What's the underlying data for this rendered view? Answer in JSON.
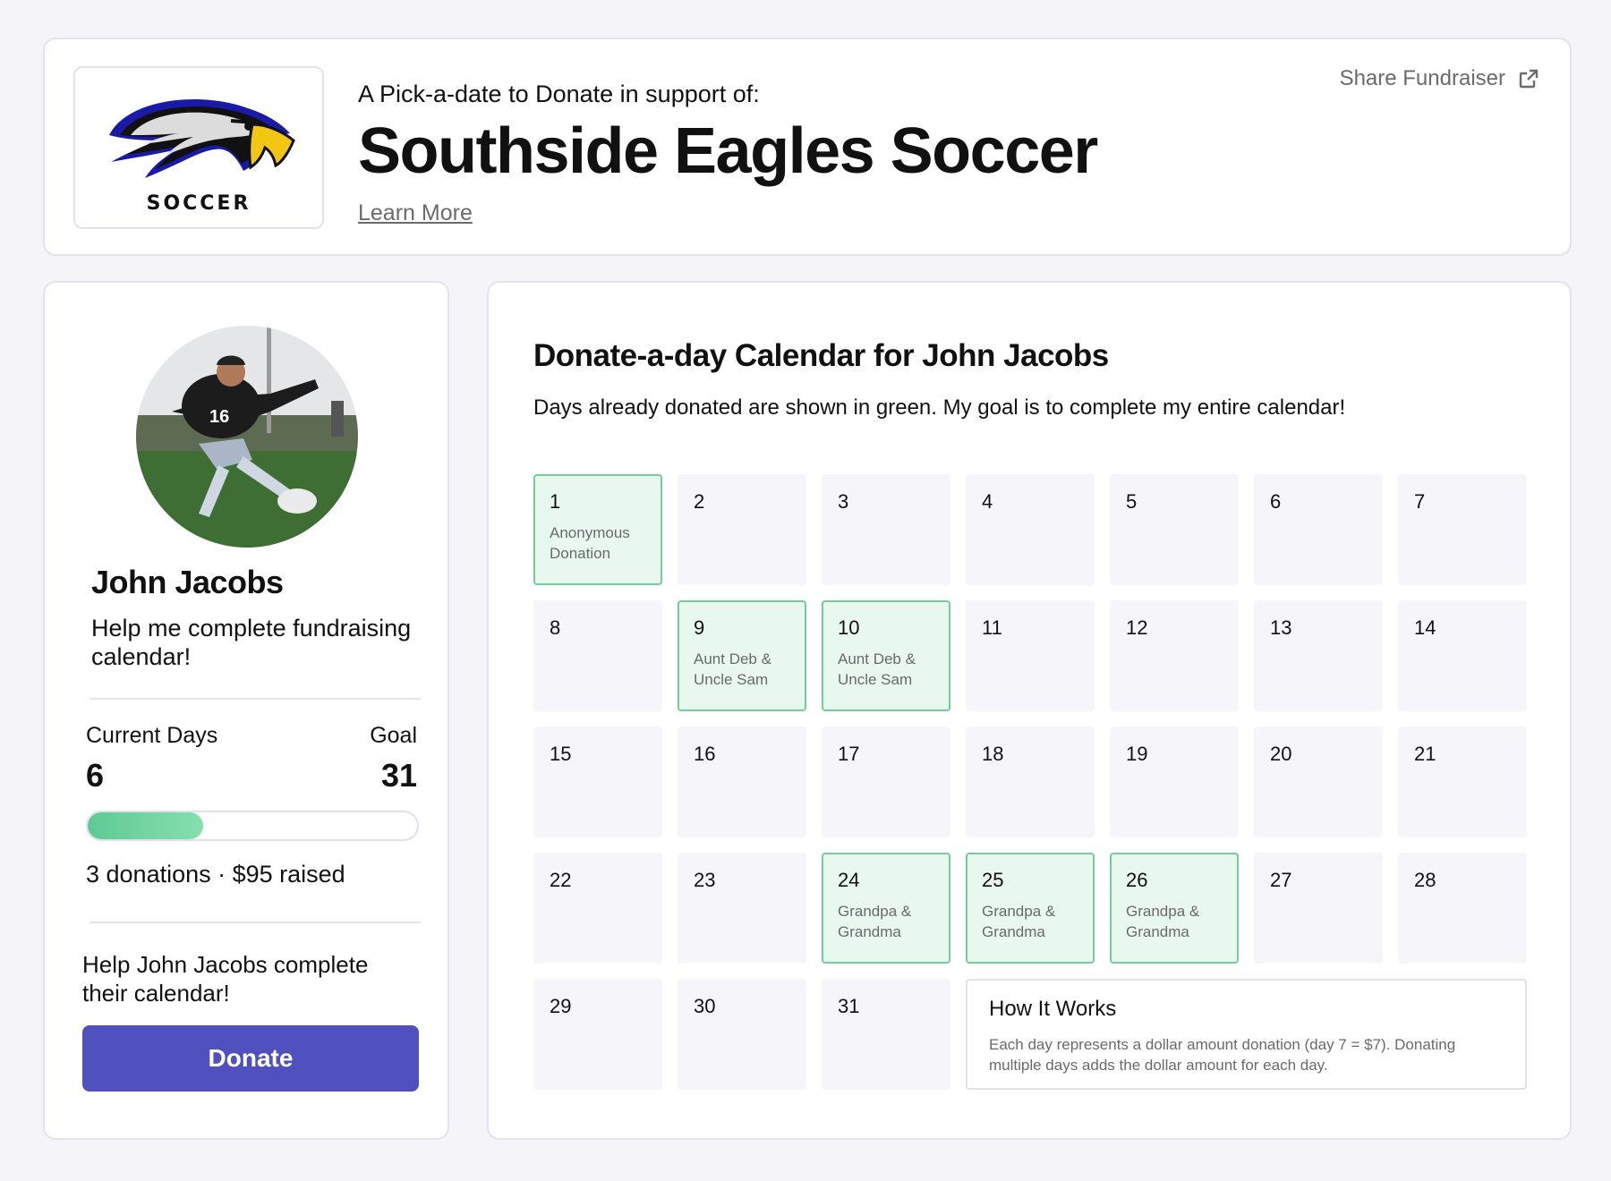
{
  "header": {
    "logo_text": "SOCCER",
    "subtitle": "A Pick-a-date to Donate in support of:",
    "title": "Southside Eagles Soccer",
    "learn_more": "Learn More",
    "share_label": "Share Fundraiser"
  },
  "profile": {
    "name": "John Jacobs",
    "tagline": "Help me complete fundraising calendar!",
    "current_days_label": "Current Days",
    "current_days_value": "6",
    "goal_label": "Goal",
    "goal_value": "31",
    "progress_fraction": 0.35,
    "stats": "3 donations · $95 raised",
    "help_text": "Help John Jacobs complete their calendar!",
    "donate_label": "Donate"
  },
  "calendar": {
    "title": "Donate-a-day Calendar for John Jacobs",
    "description": "Days already donated are shown in green. My goal is to complete my entire calendar!",
    "days": [
      {
        "num": "1",
        "donor": "Anonymous Donation",
        "donated": true
      },
      {
        "num": "2",
        "donor": "",
        "donated": false
      },
      {
        "num": "3",
        "donor": "",
        "donated": false
      },
      {
        "num": "4",
        "donor": "",
        "donated": false
      },
      {
        "num": "5",
        "donor": "",
        "donated": false
      },
      {
        "num": "6",
        "donor": "",
        "donated": false
      },
      {
        "num": "7",
        "donor": "",
        "donated": false
      },
      {
        "num": "8",
        "donor": "",
        "donated": false
      },
      {
        "num": "9",
        "donor": "Aunt Deb & Uncle Sam",
        "donated": true
      },
      {
        "num": "10",
        "donor": "Aunt Deb & Uncle Sam",
        "donated": true
      },
      {
        "num": "11",
        "donor": "",
        "donated": false
      },
      {
        "num": "12",
        "donor": "",
        "donated": false
      },
      {
        "num": "13",
        "donor": "",
        "donated": false
      },
      {
        "num": "14",
        "donor": "",
        "donated": false
      },
      {
        "num": "15",
        "donor": "",
        "donated": false
      },
      {
        "num": "16",
        "donor": "",
        "donated": false
      },
      {
        "num": "17",
        "donor": "",
        "donated": false
      },
      {
        "num": "18",
        "donor": "",
        "donated": false
      },
      {
        "num": "19",
        "donor": "",
        "donated": false
      },
      {
        "num": "20",
        "donor": "",
        "donated": false
      },
      {
        "num": "21",
        "donor": "",
        "donated": false
      },
      {
        "num": "22",
        "donor": "",
        "donated": false
      },
      {
        "num": "23",
        "donor": "",
        "donated": false
      },
      {
        "num": "24",
        "donor": "Grandpa & Grandma",
        "donated": true
      },
      {
        "num": "25",
        "donor": "Grandpa & Grandma",
        "donated": true
      },
      {
        "num": "26",
        "donor": "Grandpa & Grandma",
        "donated": true
      },
      {
        "num": "27",
        "donor": "",
        "donated": false
      },
      {
        "num": "28",
        "donor": "",
        "donated": false
      },
      {
        "num": "29",
        "donor": "",
        "donated": false
      },
      {
        "num": "30",
        "donor": "",
        "donated": false
      },
      {
        "num": "31",
        "donor": "",
        "donated": false
      }
    ],
    "how_it_works": {
      "title": "How It Works",
      "body": "Each day represents a dollar amount donation (day 7 = $7). Donating multiple days adds the dollar amount for each day."
    }
  },
  "colors": {
    "accent": "#5150bf",
    "donated_bg": "#e8f8ef",
    "donated_border": "#72cf9d",
    "progress": "#5ec994"
  },
  "icons": [
    "eagle-logo",
    "external-link-icon"
  ]
}
